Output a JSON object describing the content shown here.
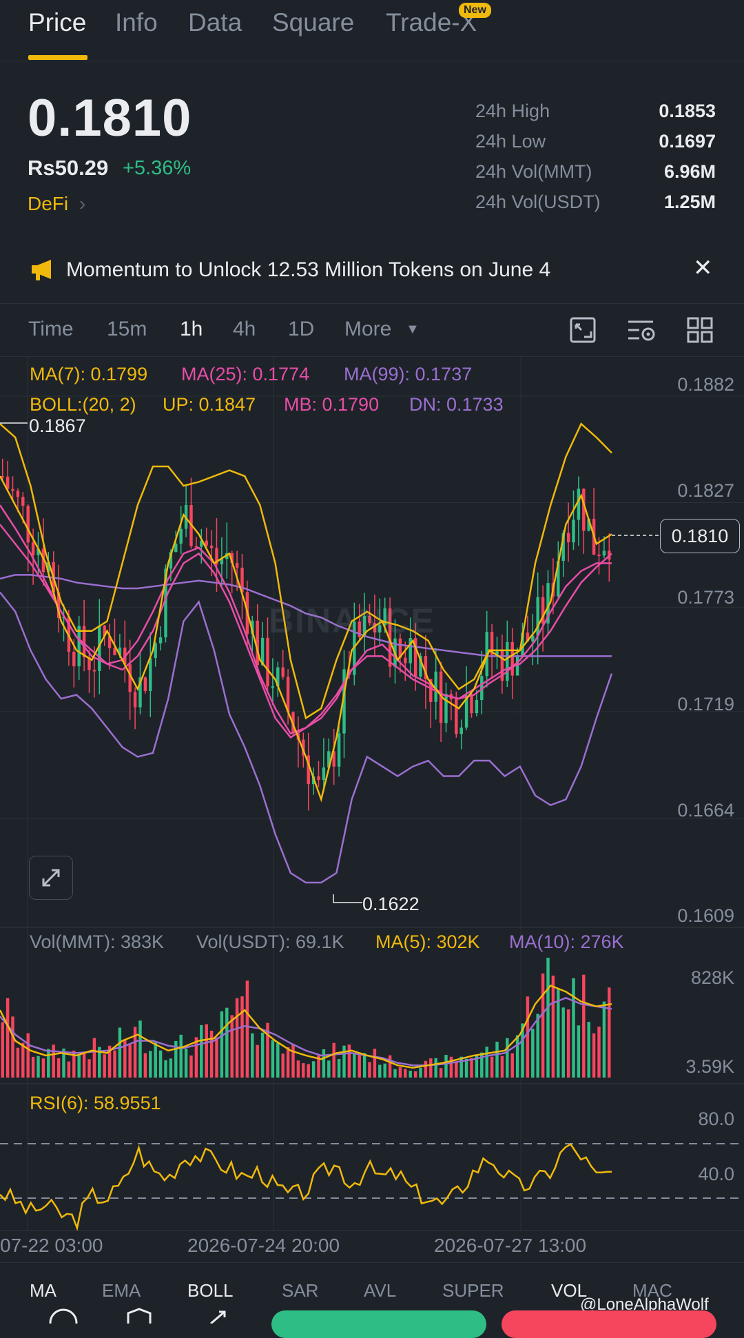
{
  "tabs": [
    {
      "label": "Price",
      "active": true
    },
    {
      "label": "Info",
      "active": false
    },
    {
      "label": "Data",
      "active": false
    },
    {
      "label": "Square",
      "active": false
    },
    {
      "label": "Trade-X",
      "active": false,
      "badge": "New"
    }
  ],
  "price": {
    "last": "0.1810",
    "local": "Rs50.29",
    "change": "+5.36%",
    "tag": "DeFi"
  },
  "stats": [
    {
      "label": "24h High",
      "value": "0.1853"
    },
    {
      "label": "24h Low",
      "value": "0.1697"
    },
    {
      "label": "24h Vol(MMT)",
      "value": "6.96M"
    },
    {
      "label": "24h Vol(USDT)",
      "value": "1.25M"
    }
  ],
  "announcement": {
    "text": "Momentum to Unlock 12.53 Million Tokens on June 4",
    "icon": "megaphone-icon"
  },
  "intervals": [
    {
      "label": "Time",
      "active": false
    },
    {
      "label": "15m",
      "active": false
    },
    {
      "label": "1h",
      "active": true
    },
    {
      "label": "4h",
      "active": false
    },
    {
      "label": "1D",
      "active": false
    },
    {
      "label": "More",
      "active": false
    }
  ],
  "toolbar_icons": [
    "chart-type-icon",
    "indicator-settings-icon",
    "layout-grid-icon"
  ],
  "legend": {
    "ma7": "MA(7): 0.1799",
    "ma25": "MA(25): 0.1774",
    "ma99": "MA(99): 0.1737",
    "boll": "BOLL:(20, 2)",
    "up": "UP: 0.1847",
    "mb": "MB: 0.1790",
    "dn": "DN: 0.1733",
    "vol_mmt": "Vol(MMT): 383K",
    "vol_usdt": "Vol(USDT): 69.1K",
    "vol_ma5": "MA(5): 302K",
    "vol_ma10": "MA(10): 276K",
    "rsi": "RSI(6): 58.9551"
  },
  "markers": {
    "high": "0.1867",
    "low": "0.1622",
    "current": "0.1810"
  },
  "watermark_logo": "BINANCE",
  "colors": {
    "accent": "#f0b90b",
    "up": "#2ebd85",
    "down": "#f6465d",
    "ma7": "#f0b90b",
    "ma25": "#e84da8",
    "ma99": "#9b6fd1",
    "text_secondary": "#848e9c"
  },
  "indicator_tabs": [
    {
      "label": "MA",
      "on": true
    },
    {
      "label": "EMA",
      "on": false
    },
    {
      "label": "BOLL",
      "on": true
    },
    {
      "label": "SAR",
      "on": false
    },
    {
      "label": "AVL",
      "on": false
    },
    {
      "label": "SUPER",
      "on": false
    },
    {
      "label": "VOL",
      "on": true
    },
    {
      "label": "MAC",
      "on": false
    }
  ],
  "watermark": "@LoneAlphaWolf",
  "chart_data": {
    "type": "candlestick",
    "interval": "1h",
    "price_axis": {
      "ticks": [
        "0.1882",
        "0.1827",
        "0.1773",
        "0.1719",
        "0.1664",
        "0.1609"
      ],
      "ylim": [
        0.1609,
        0.1882
      ]
    },
    "volume_axis": {
      "ticks": [
        "828K",
        "3.59K"
      ]
    },
    "rsi_axis": {
      "ticks": [
        "80.0",
        "40.0"
      ]
    },
    "x_ticks": [
      "07-22 03:00",
      "2026-07-24 20:00",
      "2026-07-27 13:00"
    ],
    "ma7": [
      0.1835,
      0.182,
      0.1805,
      0.179,
      0.176,
      0.1745,
      0.174,
      0.1755,
      0.174,
      0.1725,
      0.1745,
      0.179,
      0.1815,
      0.1805,
      0.179,
      0.1795,
      0.177,
      0.174,
      0.173,
      0.171,
      0.169,
      0.1668,
      0.17,
      0.1745,
      0.1755,
      0.176,
      0.174,
      0.175,
      0.173,
      0.172,
      0.1715,
      0.1725,
      0.1745,
      0.174,
      0.1745,
      0.1755,
      0.177,
      0.181,
      0.1825,
      0.18,
      0.1805
    ],
    "ma25": [
      0.181,
      0.18,
      0.179,
      0.1778,
      0.1765,
      0.1752,
      0.1745,
      0.1738,
      0.1735,
      0.1742,
      0.1755,
      0.1775,
      0.179,
      0.1795,
      0.1785,
      0.177,
      0.175,
      0.173,
      0.171,
      0.17,
      0.1705,
      0.171,
      0.172,
      0.1735,
      0.1745,
      0.1748,
      0.174,
      0.1732,
      0.1728,
      0.1722,
      0.172,
      0.1725,
      0.173,
      0.1735,
      0.1738,
      0.1745,
      0.1755,
      0.1768,
      0.178,
      0.1788,
      0.1795
    ],
    "ma99": [
      0.1782,
      0.1784,
      0.1784,
      0.1783,
      0.1782,
      0.178,
      0.1779,
      0.1778,
      0.1777,
      0.1777,
      0.1778,
      0.1779,
      0.178,
      0.1781,
      0.178,
      0.1779,
      0.1777,
      0.1774,
      0.1771,
      0.1768,
      0.1764,
      0.1762,
      0.1758,
      0.1755,
      0.1752,
      0.175,
      0.1748,
      0.1747,
      0.1746,
      0.1745,
      0.1744,
      0.1743,
      0.1742,
      0.1742,
      0.1742,
      0.1742,
      0.1742,
      0.1742,
      0.1742,
      0.1742,
      0.1742
    ],
    "boll_up": [
      0.1862,
      0.1855,
      0.183,
      0.1795,
      0.177,
      0.1755,
      0.1755,
      0.176,
      0.179,
      0.182,
      0.184,
      0.184,
      0.183,
      0.1832,
      0.1835,
      0.1838,
      0.1835,
      0.182,
      0.179,
      0.174,
      0.171,
      0.1715,
      0.174,
      0.176,
      0.1765,
      0.176,
      0.1758,
      0.1755,
      0.175,
      0.1735,
      0.1725,
      0.173,
      0.1745,
      0.1745,
      0.1745,
      0.179,
      0.182,
      0.1845,
      0.1862,
      0.1855,
      0.1847
    ],
    "boll_mb": [
      0.182,
      0.1808,
      0.1795,
      0.178,
      0.1765,
      0.1752,
      0.1742,
      0.1738,
      0.174,
      0.175,
      0.1765,
      0.1782,
      0.1795,
      0.1798,
      0.179,
      0.1775,
      0.1755,
      0.1732,
      0.1715,
      0.1702,
      0.1705,
      0.1712,
      0.1722,
      0.1735,
      0.1742,
      0.1742,
      0.1736,
      0.173,
      0.1726,
      0.1722,
      0.172,
      0.1722,
      0.1728,
      0.1733,
      0.174,
      0.175,
      0.1765,
      0.1778,
      0.1786,
      0.179,
      0.179
    ],
    "boll_dn": [
      0.1775,
      0.1765,
      0.1745,
      0.173,
      0.172,
      0.1722,
      0.1715,
      0.1705,
      0.1695,
      0.169,
      0.1692,
      0.172,
      0.176,
      0.177,
      0.1745,
      0.1712,
      0.1695,
      0.1675,
      0.165,
      0.163,
      0.1625,
      0.1625,
      0.163,
      0.1668,
      0.169,
      0.1685,
      0.168,
      0.1685,
      0.1688,
      0.168,
      0.168,
      0.1688,
      0.1688,
      0.168,
      0.1685,
      0.167,
      0.1665,
      0.1668,
      0.1685,
      0.171,
      0.1733
    ],
    "rsi": [
      45,
      38,
      30,
      35,
      28,
      24,
      42,
      40,
      50,
      75,
      60,
      55,
      70,
      72,
      68,
      62,
      55,
      60,
      48,
      42,
      45,
      58,
      65,
      50,
      62,
      55,
      58,
      45,
      40,
      35,
      45,
      60,
      70,
      58,
      48,
      52,
      60,
      78,
      72,
      55,
      59
    ],
    "volume_ma5": [
      0.55,
      0.3,
      0.22,
      0.18,
      0.2,
      0.18,
      0.22,
      0.2,
      0.3,
      0.35,
      0.28,
      0.22,
      0.25,
      0.3,
      0.32,
      0.45,
      0.55,
      0.4,
      0.3,
      0.22,
      0.18,
      0.15,
      0.2,
      0.22,
      0.18,
      0.15,
      0.1,
      0.08,
      0.1,
      0.12,
      0.15,
      0.18,
      0.2,
      0.22,
      0.35,
      0.6,
      0.75,
      0.7,
      0.62,
      0.58,
      0.6
    ],
    "volume_ma10": [
      0.5,
      0.35,
      0.26,
      0.22,
      0.21,
      0.2,
      0.21,
      0.22,
      0.25,
      0.3,
      0.3,
      0.26,
      0.24,
      0.27,
      0.3,
      0.38,
      0.42,
      0.4,
      0.35,
      0.28,
      0.22,
      0.18,
      0.19,
      0.2,
      0.18,
      0.16,
      0.12,
      0.1,
      0.1,
      0.11,
      0.13,
      0.15,
      0.18,
      0.2,
      0.28,
      0.45,
      0.6,
      0.65,
      0.6,
      0.58,
      0.56
    ]
  }
}
